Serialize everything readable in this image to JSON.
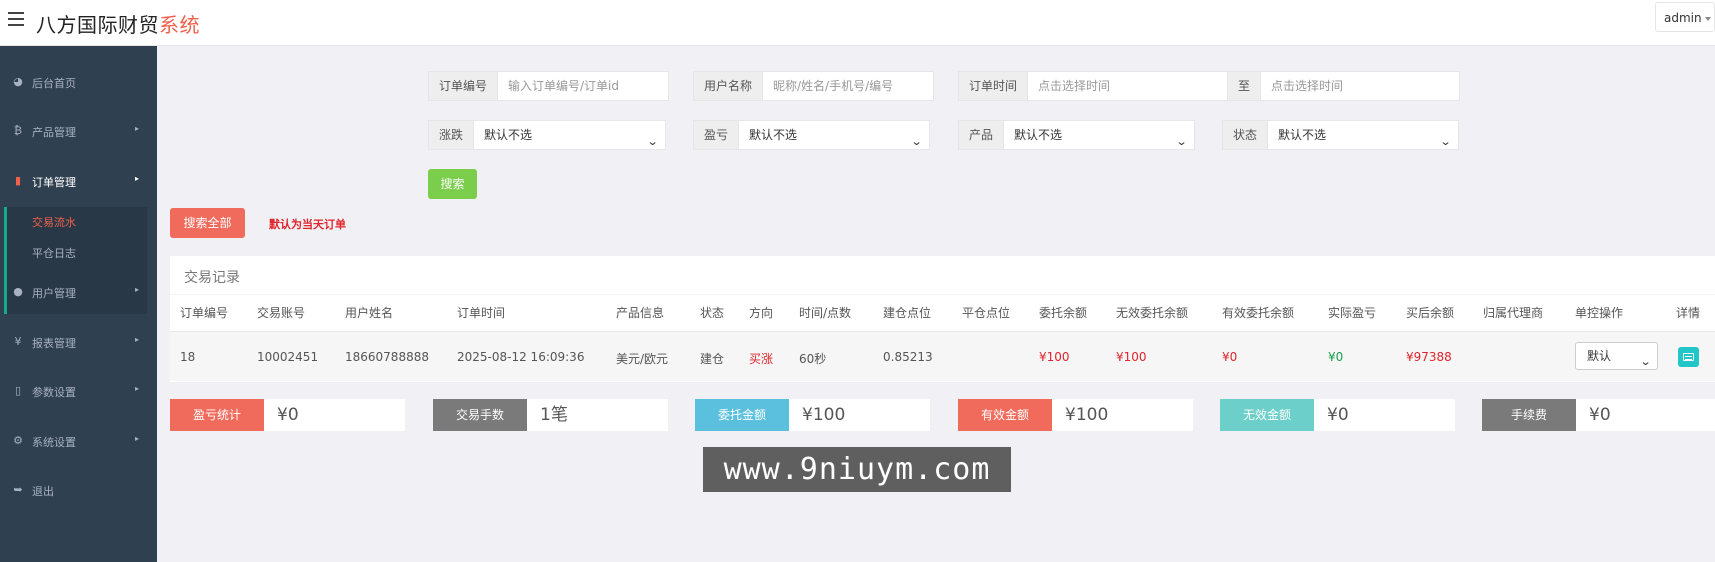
{
  "header": {
    "title_main": "八方国际财贸",
    "title_accent": "系统",
    "user": "admin"
  },
  "sidebar": {
    "items": [
      {
        "icon": "palette-icon",
        "glyph": "◕",
        "label": "后台首页",
        "has_arrow": false
      },
      {
        "icon": "bitcoin-icon",
        "glyph": "₿",
        "label": "产品管理",
        "has_arrow": true
      },
      {
        "icon": "file-icon",
        "glyph": "▮",
        "label": "订单管理",
        "has_arrow": true
      },
      {
        "icon": "user-icon",
        "glyph": "●",
        "label": "用户管理",
        "has_arrow": true
      },
      {
        "icon": "yen-icon",
        "glyph": "¥",
        "label": "报表管理",
        "has_arrow": true
      },
      {
        "icon": "copy-icon",
        "glyph": "▯",
        "label": "参数设置",
        "has_arrow": true
      },
      {
        "icon": "gears-icon",
        "glyph": "⚙",
        "label": "系统设置",
        "has_arrow": true
      },
      {
        "icon": "signout-icon",
        "glyph": "➥",
        "label": "退出",
        "has_arrow": false
      }
    ],
    "order_sub": [
      {
        "label": "交易流水",
        "active": true
      },
      {
        "label": "平仓日志",
        "active": false
      }
    ],
    "arrow": "▸"
  },
  "filters": {
    "order_no": {
      "label": "订单编号",
      "placeholder": "输入订单编号/订单id"
    },
    "username": {
      "label": "用户名称",
      "placeholder": "昵称/姓名/手机号/编号"
    },
    "order_time": {
      "label": "订单时间",
      "placeholder": "点击选择时间"
    },
    "to": {
      "label": "至",
      "placeholder": "点击选择时间"
    },
    "updown": {
      "label": "涨跌",
      "value": "默认不选"
    },
    "profit": {
      "label": "盈亏",
      "value": "默认不选"
    },
    "product": {
      "label": "产品",
      "value": "默认不选"
    },
    "status": {
      "label": "状态",
      "value": "默认不选"
    },
    "chevron": "⌄",
    "search_button": "搜索",
    "search_all_button": "搜索全部",
    "default_note": "默认为当天订单"
  },
  "table": {
    "title": "交易记录",
    "columns": [
      "订单编号",
      "交易账号",
      "用户姓名",
      "订单时间",
      "产品信息",
      "状态",
      "方向",
      "时间/点数",
      "建仓点位",
      "平仓点位",
      "委托余额",
      "无效委托余额",
      "有效委托余额",
      "实际盈亏",
      "买后余额",
      "归属代理商",
      "单控操作",
      "详情"
    ],
    "rows": [
      {
        "order_no": "18",
        "account": "10002451",
        "user": "18660788888",
        "time": "2025-08-12 16:09:36",
        "product": "美元/欧元",
        "status": "建仓",
        "direction": "买涨",
        "duration": "60秒",
        "open_price": "0.85213",
        "close_price": "",
        "entrust": "¥100",
        "invalid_entrust": "¥100",
        "valid_entrust": "¥0",
        "actual_pnl": "¥0",
        "after_balance": "¥97388",
        "agent": "",
        "control": "默认"
      }
    ]
  },
  "stats": [
    {
      "label": "盈亏统计",
      "value": "¥0",
      "color": "#f06b5c"
    },
    {
      "label": "交易手数",
      "value": "1笔",
      "color": "#7a7a7a"
    },
    {
      "label": "委托金额",
      "value": "¥100",
      "color": "#5bc0de"
    },
    {
      "label": "有效金额",
      "value": "¥100",
      "color": "#f06b5c"
    },
    {
      "label": "无效金额",
      "value": "¥0",
      "color": "#6ccfc9"
    },
    {
      "label": "手续费",
      "value": "¥0",
      "color": "#7a7a7a"
    }
  ],
  "watermark": "www.9niuym.com",
  "colors": {
    "sidebar_bg": "#2f4050",
    "accent_red": "#f0604c",
    "search_green": "#7bcd4c"
  }
}
